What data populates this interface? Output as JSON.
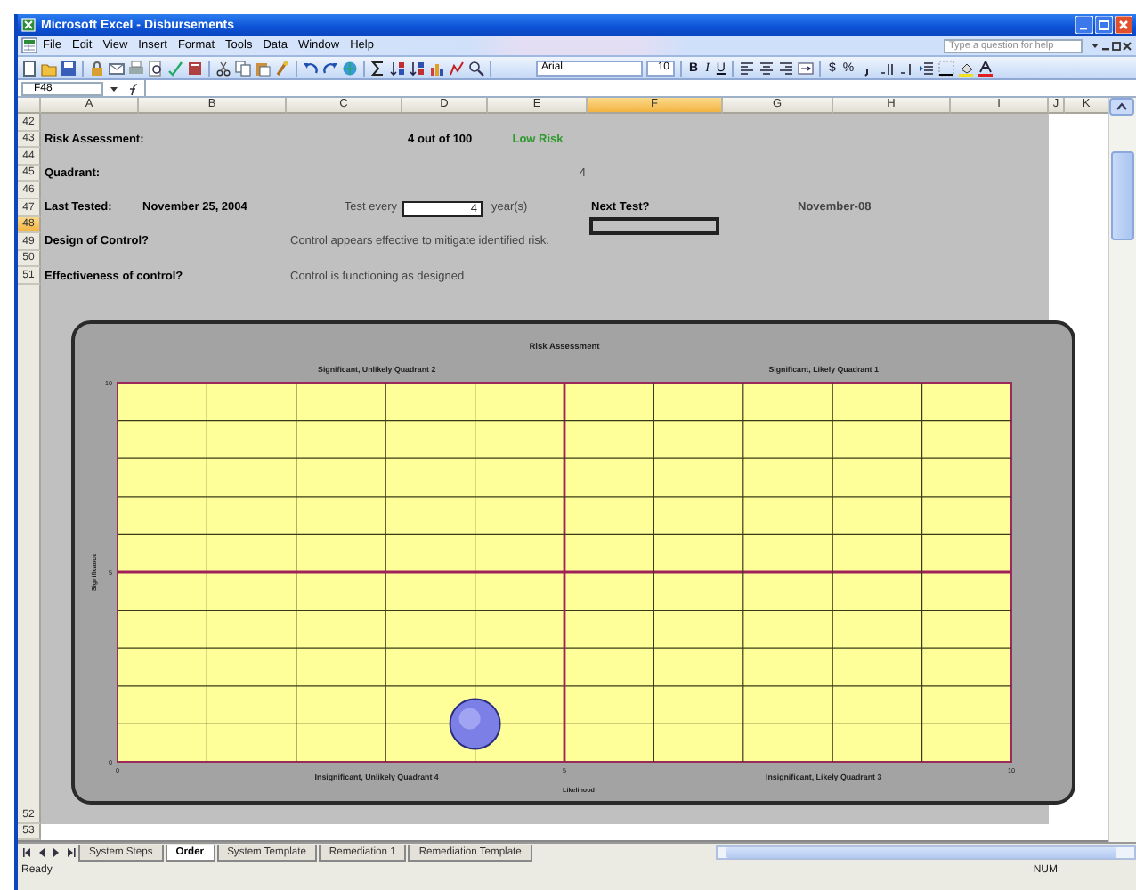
{
  "window": {
    "title": "Microsoft Excel - Disbursements"
  },
  "menu": [
    {
      "label": "File"
    },
    {
      "label": "Edit"
    },
    {
      "label": "View"
    },
    {
      "label": "Insert"
    },
    {
      "label": "Format"
    },
    {
      "label": "Tools"
    },
    {
      "label": "Data"
    },
    {
      "label": "Window"
    },
    {
      "label": "Help"
    }
  ],
  "help_box": {
    "placeholder": "Type a question for help"
  },
  "format_toolbar": {
    "font": "Arial",
    "size": "10",
    "buttons": [
      {
        "label": "B",
        "kind": "bold"
      },
      {
        "label": "I",
        "kind": "italic"
      },
      {
        "label": "U",
        "kind": "underline"
      }
    ],
    "number_buttons": [
      {
        "label": "$"
      },
      {
        "label": "%"
      }
    ]
  },
  "formula_bar": {
    "name_box": "F48"
  },
  "columns": [
    {
      "label": "A",
      "selected": false
    },
    {
      "label": "B",
      "selected": false
    },
    {
      "label": "C",
      "selected": false
    },
    {
      "label": "D",
      "selected": false
    },
    {
      "label": "E",
      "selected": false
    },
    {
      "label": "F",
      "selected": true
    },
    {
      "label": "G",
      "selected": false
    },
    {
      "label": "H",
      "selected": false
    },
    {
      "label": "I",
      "selected": false
    },
    {
      "label": "J",
      "selected": false
    },
    {
      "label": "K",
      "selected": false
    }
  ],
  "rows": [
    {
      "number": "42",
      "selected": false,
      "kind": "form"
    },
    {
      "number": "43",
      "selected": false,
      "kind": "form",
      "cells": {
        "A": {
          "text": "Risk Assessment:",
          "kind": "label"
        },
        "D": {
          "text": "4 out of 100",
          "kind": "score"
        },
        "E": {
          "text": "Low Risk",
          "kind": "status",
          "color": "#2e9a2e"
        }
      }
    },
    {
      "number": "44",
      "selected": false,
      "kind": "form"
    },
    {
      "number": "45",
      "selected": false,
      "kind": "form",
      "cells": {
        "A": {
          "text": "Quadrant:",
          "kind": "label"
        },
        "E": {
          "text": "4",
          "kind": "number"
        }
      }
    },
    {
      "number": "46",
      "selected": false,
      "kind": "form"
    },
    {
      "number": "47",
      "selected": false,
      "kind": "form",
      "cells": {
        "A": {
          "text": "Last Tested:",
          "kind": "label"
        },
        "B": {
          "text": "November 25, 2004",
          "kind": "label"
        },
        "C": {
          "text": "Test every",
          "kind": "prompt"
        },
        "D": {
          "text": "4",
          "kind": "input"
        },
        "E": {
          "text": "year(s)",
          "kind": "text"
        },
        "F": {
          "text": "Next Test?",
          "kind": "label"
        },
        "G": {
          "text": "November-08",
          "kind": "date"
        }
      }
    },
    {
      "number": "48",
      "selected": true,
      "kind": "form"
    },
    {
      "number": "49",
      "selected": false,
      "kind": "form",
      "cells": {
        "A": {
          "text": "Design of Control?",
          "kind": "label"
        },
        "C": {
          "text": "Control appears effective to mitigate identified risk.",
          "kind": "text"
        }
      }
    },
    {
      "number": "50",
      "selected": false,
      "kind": "form"
    },
    {
      "number": "51",
      "selected": false,
      "kind": "form",
      "cells": {
        "A": {
          "text": "Effectiveness of control?",
          "kind": "label"
        },
        "C": {
          "text": "Control is functioning as designed",
          "kind": "text"
        }
      }
    },
    {
      "number": "52",
      "selected": false,
      "kind": "chart"
    },
    {
      "number": "53",
      "selected": false,
      "kind": "plain"
    }
  ],
  "chart": {
    "chart_data": {
      "type": "scatter",
      "title": "Risk Assessment",
      "xlabel": "Likelihood",
      "ylabel": "Significance",
      "x": [
        4
      ],
      "series": [
        {
          "color": "#7b7fe6",
          "values": [
            1
          ]
        }
      ],
      "xlim": [
        0,
        10
      ],
      "ylim": [
        0,
        10
      ],
      "xticks": [
        0,
        5,
        10
      ],
      "yticks": [
        0,
        5,
        10
      ],
      "annotations": [
        "Significant, Unlikely Quadrant 2",
        "Significant, Likely Quadrant 1",
        "Insignificant, Unlikely Quadrant 4",
        "Insignificant, Likely Quadrant 3"
      ]
    }
  },
  "sheet_tabs": [
    {
      "label": "System Steps",
      "selected": false
    },
    {
      "label": "Order",
      "selected": true
    },
    {
      "label": "System Template",
      "selected": false
    },
    {
      "label": "Remediation 1",
      "selected": false
    },
    {
      "label": "Remediation Template",
      "selected": false
    }
  ],
  "status_bar": {
    "message": "Ready",
    "indicator": "NUM"
  }
}
